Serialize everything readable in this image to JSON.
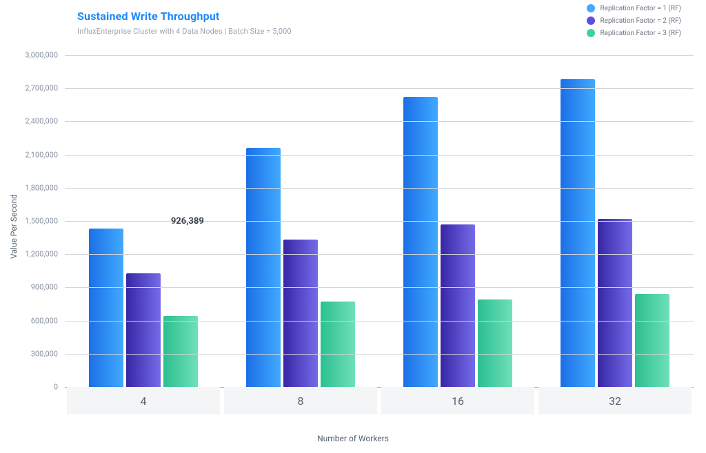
{
  "chart_data": {
    "type": "bar",
    "title": "Sustained Write Throughput",
    "subtitle": "InfluxEnterprise Cluster with 4 Data Nodes | Batch Size = 5,000",
    "xlabel": "Number of Workers",
    "ylabel": "Value Per Second",
    "categories": [
      "4",
      "8",
      "16",
      "32"
    ],
    "ylim": [
      0,
      3000000
    ],
    "y_ticks": [
      "0",
      "300,000",
      "600,000",
      "900,000",
      "1,200,000",
      "1,500,000",
      "1,800,000",
      "2,100,000",
      "2,400,000",
      "2,700,000",
      "3,000,000"
    ],
    "series": [
      {
        "name": "Replication Factor = 1 (RF)",
        "color": "#41a9ff",
        "key": "rf1",
        "values": [
          1430000,
          2160000,
          2620000,
          2780000
        ]
      },
      {
        "name": "Replication Factor = 2 (RF)",
        "color": "#5b4fe0",
        "key": "rf2",
        "values": [
          1030000,
          1330000,
          1470000,
          1520000
        ]
      },
      {
        "name": "Replication Factor = 3 (RF)",
        "color": "#3fd1a3",
        "key": "rf3",
        "values": [
          640000,
          770000,
          790000,
          840000
        ]
      }
    ],
    "annotations": [
      {
        "text": "926,389",
        "group_index": 0,
        "x_offset_pct": 78,
        "y_value": 1430000
      }
    ]
  }
}
